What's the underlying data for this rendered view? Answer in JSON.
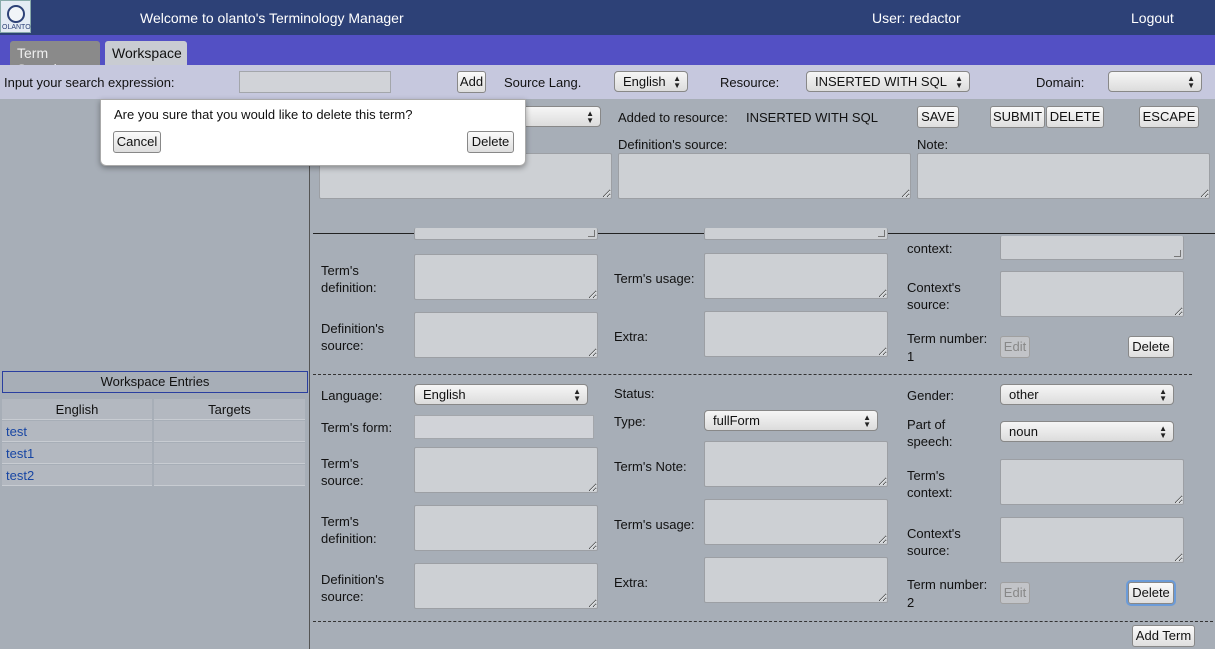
{
  "header": {
    "logo_text": "OLANTO",
    "welcome": "Welcome to olanto's Terminology Manager",
    "user": "User: redactor",
    "logout": "Logout"
  },
  "tabs": [
    {
      "label": "Term Search"
    },
    {
      "label": "Workspace"
    }
  ],
  "searchbar": {
    "prompt": "Input your search expression:",
    "search_value": "",
    "add_label": "Add",
    "source_lang_label": "Source Lang.",
    "source_lang_value": "English",
    "resource_label": "Resource:",
    "resource_value": "INSERTED WITH SQL",
    "domain_label": "Domain:",
    "domain_value": ""
  },
  "dialog": {
    "message": "Are you sure that you would like to delete this term?",
    "cancel": "Cancel",
    "delete": "Delete"
  },
  "concept": {
    "added_label": "Added to resource:",
    "added_value": "INSERTED WITH SQL",
    "save": "SAVE",
    "submit": "SUBMIT",
    "delete": "DELETE",
    "escape": "ESCAPE",
    "def_source_label": "Definition's source:",
    "note_label": "Note:"
  },
  "term1": {
    "definition_label": "Term's definition:",
    "def_source_label": "Definition's source:",
    "usage_label": "Term's usage:",
    "extra_label": "Extra:",
    "context_label": "context:",
    "context_source_label": "Context's source:",
    "term_number_label": "Term number:",
    "term_number": "1",
    "edit": "Edit",
    "delete": "Delete"
  },
  "term2": {
    "language_label": "Language:",
    "language_value": "English",
    "status_label": "Status:",
    "gender_label": "Gender:",
    "gender_value": "other",
    "form_label": "Term's form:",
    "type_label": "Type:",
    "type_value": "fullForm",
    "pos_label": "Part of speech:",
    "pos_value": "noun",
    "source_label": "Term's source:",
    "note_label": "Term's Note:",
    "context_label": "Term's context:",
    "definition_label": "Term's definition:",
    "usage_label": "Term's usage:",
    "context_source_label": "Context's source:",
    "def_source_label": "Definition's source:",
    "extra_label": "Extra:",
    "term_number_label": "Term number:",
    "term_number": "2",
    "edit": "Edit",
    "delete": "Delete"
  },
  "add_term": "Add Term",
  "workspace": {
    "title": "Workspace Entries",
    "col_english": "English",
    "col_targets": "Targets",
    "entries": [
      {
        "english": "test",
        "targets": ""
      },
      {
        "english": "test1",
        "targets": ""
      },
      {
        "english": "test2",
        "targets": ""
      }
    ]
  }
}
